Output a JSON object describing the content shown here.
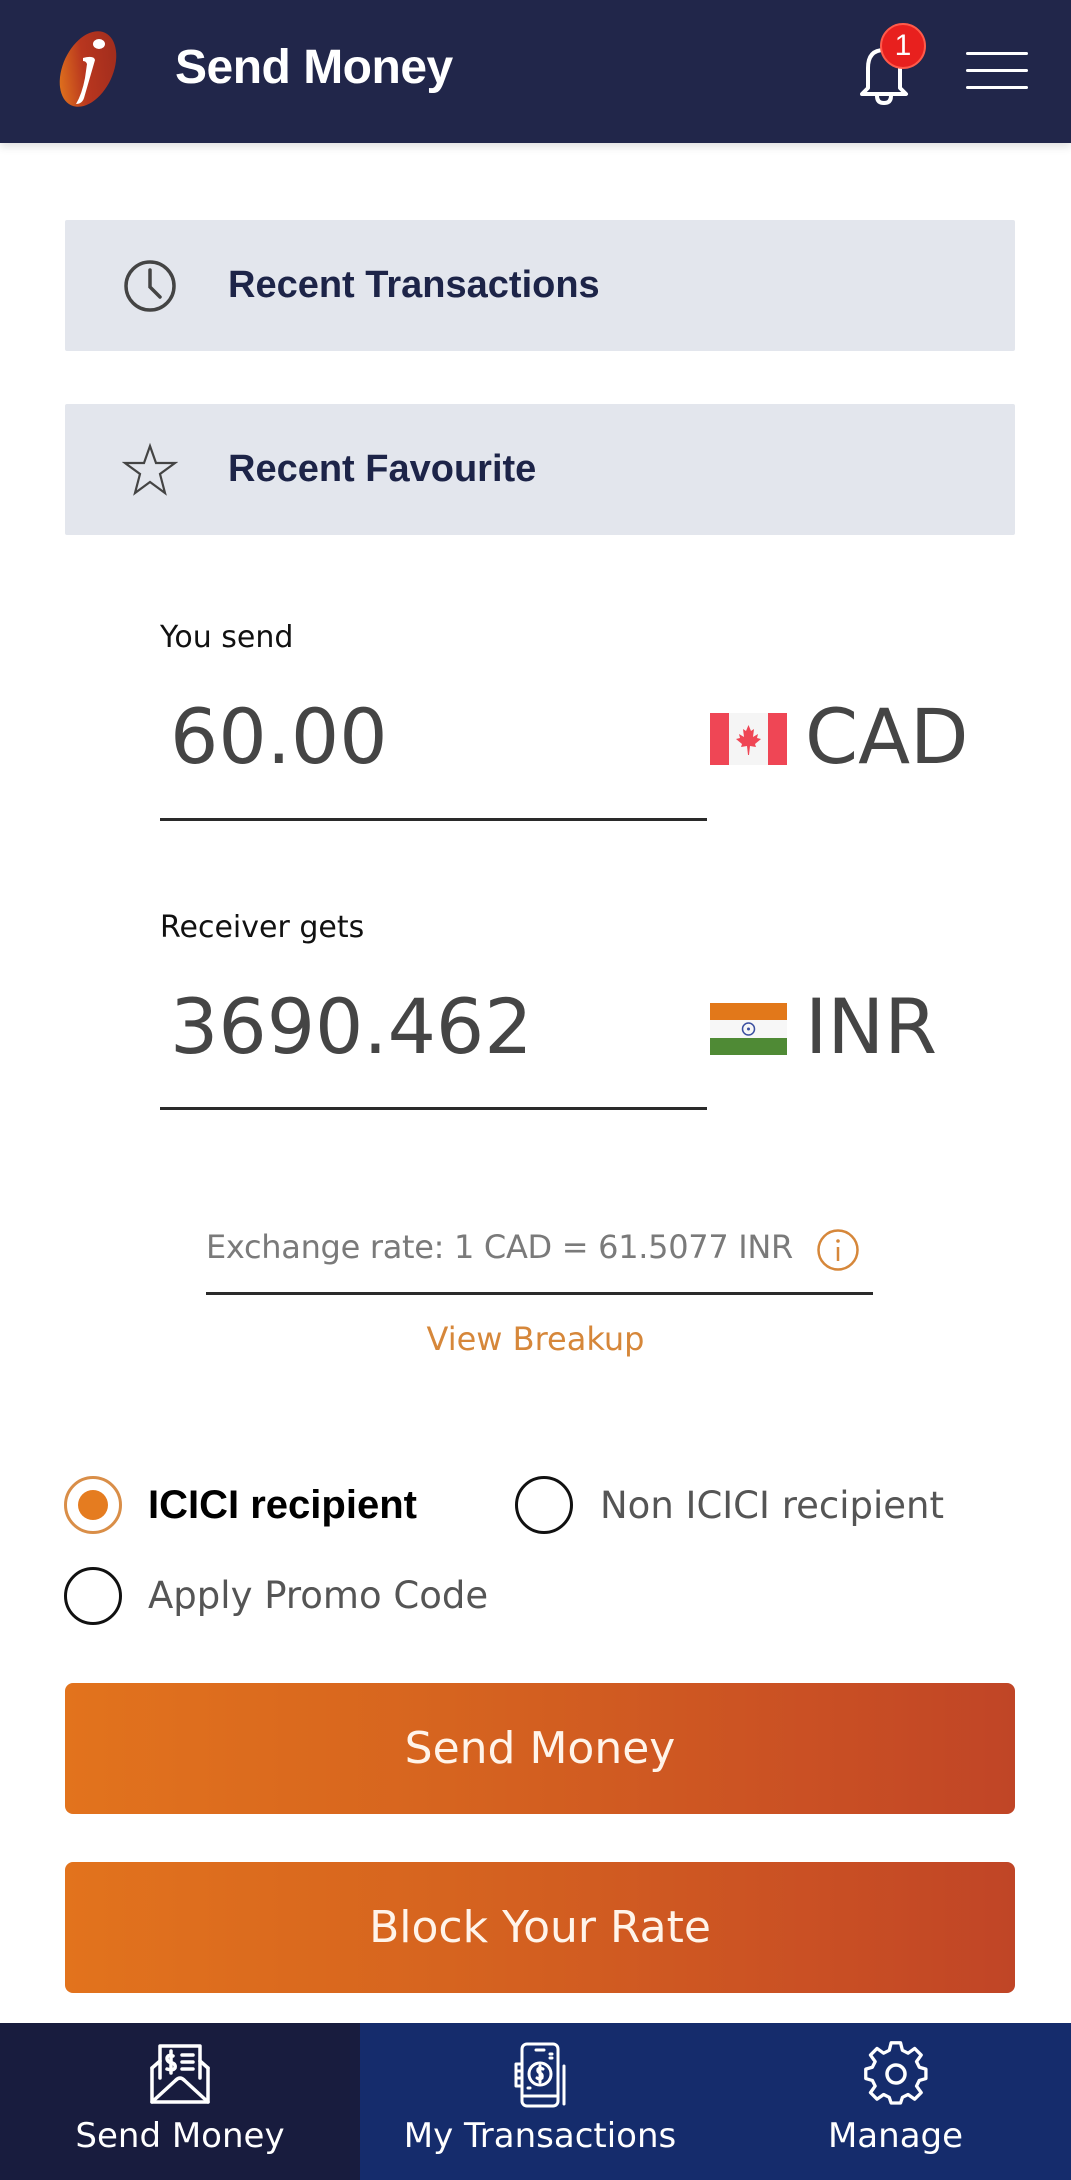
{
  "header": {
    "title": "Send Money",
    "logo": "icici-logo",
    "notification_icon": "bell-icon",
    "notification_count": "1",
    "menu_icon": "hamburger-menu-icon"
  },
  "panels": [
    {
      "label": "Recent Transactions",
      "icon": "clock-icon"
    },
    {
      "label": "Recent Favourite",
      "icon": "star-icon"
    }
  ],
  "send": {
    "label": "You send",
    "amount": "60.00",
    "currency": "CAD",
    "flag": "canada-flag"
  },
  "receive": {
    "label": "Receiver gets",
    "amount": "3690.462",
    "currency": "INR",
    "flag": "india-flag"
  },
  "exchange": {
    "rate_text": "Exchange rate: 1 CAD = 61.5077 INR",
    "info_icon": "info-icon",
    "view_breakup": "View Breakup"
  },
  "options": {
    "recipient_types": [
      {
        "label": "ICICI recipient",
        "selected": true
      },
      {
        "label": "Non ICICI recipient",
        "selected": false
      }
    ],
    "promo": {
      "label": "Apply Promo Code",
      "selected": false
    }
  },
  "buttons": {
    "send_money": "Send Money",
    "block_rate": "Block Your Rate"
  },
  "bottom_nav": [
    {
      "label": "Send Money",
      "icon": "money-envelope-icon",
      "active": true
    },
    {
      "label": "My Transactions",
      "icon": "mobile-payment-icon",
      "active": false
    },
    {
      "label": "Manage",
      "icon": "gear-icon",
      "active": false
    }
  ],
  "colors": {
    "header_bg": "#21264a",
    "accent_orange": "#e57c20",
    "nav_bg": "#152c6c",
    "nav_active_bg": "#181c3e",
    "panel_bg": "#e3e6ed",
    "badge_red": "#e8201e"
  }
}
